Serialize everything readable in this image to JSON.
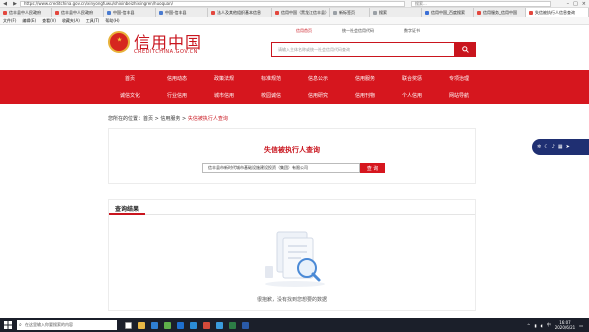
{
  "browser": {
    "url": "https://www.creditchina.gov.cn/xinyongfuwu/shixinbeizhixingren/huoquan/",
    "search_placeholder": "搜索...",
    "tabs": [
      {
        "label": "信丰县中人民政府",
        "color": "#e3473e"
      },
      {
        "label": "信丰县中人民政府",
        "color": "#e3473e"
      },
      {
        "label": "中国-信丰县",
        "color": "#4a7bd0"
      },
      {
        "label": "中国-信丰县",
        "color": "#4a7bd0"
      },
      {
        "label": "法人及其他组织基本信息",
        "color": "#e3473e"
      },
      {
        "label": "信用中国（黑龙江信丰县）",
        "color": "#e3473e"
      },
      {
        "label": "新标签页",
        "color": "#9aa0a6"
      },
      {
        "label": "搜索",
        "color": "#9aa0a6"
      },
      {
        "label": "信用中国_百度搜索",
        "color": "#3b6fd6"
      },
      {
        "label": "信用服务_信用中国",
        "color": "#e3473e"
      },
      {
        "label": "失信被执行人信息查询",
        "color": "#e3473e"
      }
    ],
    "menu": [
      "文件(F)",
      "编辑(E)",
      "查看(V)",
      "收藏夹(A)",
      "工具(T)",
      "帮助(H)"
    ]
  },
  "site": {
    "logo_cn": "信用中国",
    "logo_en": "CREDITCHINA.GOV.CN",
    "top_links": [
      "信用首页",
      "统一社会信用代码",
      "数字证书"
    ],
    "search_placeholder": "请输入主体名称或统一社会信用代码查询",
    "nav_row1": [
      "首页",
      "信用动态",
      "政策法规",
      "标准规范",
      "信息公示",
      "信用服务",
      "联合奖惩",
      "专项治理"
    ],
    "nav_row2": [
      "诚信文化",
      "行业信用",
      "城市信用",
      "校园诚信",
      "信用研究",
      "信用刊物",
      "个人信用",
      "网站导航"
    ],
    "breadcrumb": {
      "prefix": "您所在的位置：",
      "home": "首页",
      "sep": ">",
      "service": "信用服务",
      "current": "失信被执行人查询"
    }
  },
  "query": {
    "title": "失信被执行人查询",
    "input_value": "信丰县市新时代城市基础设施建设投资（集团）有限公司",
    "button": "查 询"
  },
  "results": {
    "title": "查询结果",
    "empty_text": "很抱歉，没有找到您想要的数据"
  },
  "taskbar": {
    "search_placeholder": "在这里输入你要搜索的内容",
    "time": "16:07",
    "date": "2020/6/21",
    "ime": "中"
  }
}
